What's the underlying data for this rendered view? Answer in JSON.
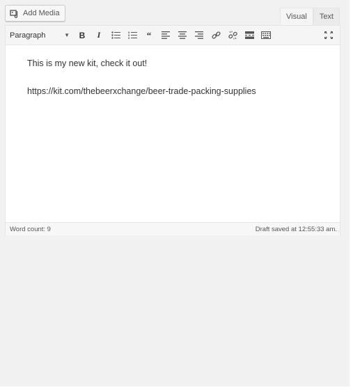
{
  "add_media": {
    "label": "Add Media",
    "icon": "media-icon"
  },
  "tabs": [
    {
      "label": "Visual",
      "active": true
    },
    {
      "label": "Text",
      "active": false
    }
  ],
  "toolbar": {
    "format_select": "Paragraph",
    "buttons": [
      "bold-icon",
      "italic-icon",
      "bullet-list-icon",
      "numbered-list-icon",
      "blockquote-icon",
      "align-left-icon",
      "align-center-icon",
      "align-right-icon",
      "link-icon",
      "unlink-icon",
      "read-more-icon",
      "toolbar-toggle-icon",
      "fullscreen-icon"
    ],
    "bold_glyph": "B",
    "italic_glyph": "I",
    "quote_glyph": "“"
  },
  "content": {
    "line1": "This is my new kit, check it out!",
    "line2": "https://kit.com/thebeerxchange/beer-trade-packing-supplies"
  },
  "status": {
    "word_count": "Word count: 9",
    "draft_saved": "Draft saved at 12:55:33 am."
  }
}
